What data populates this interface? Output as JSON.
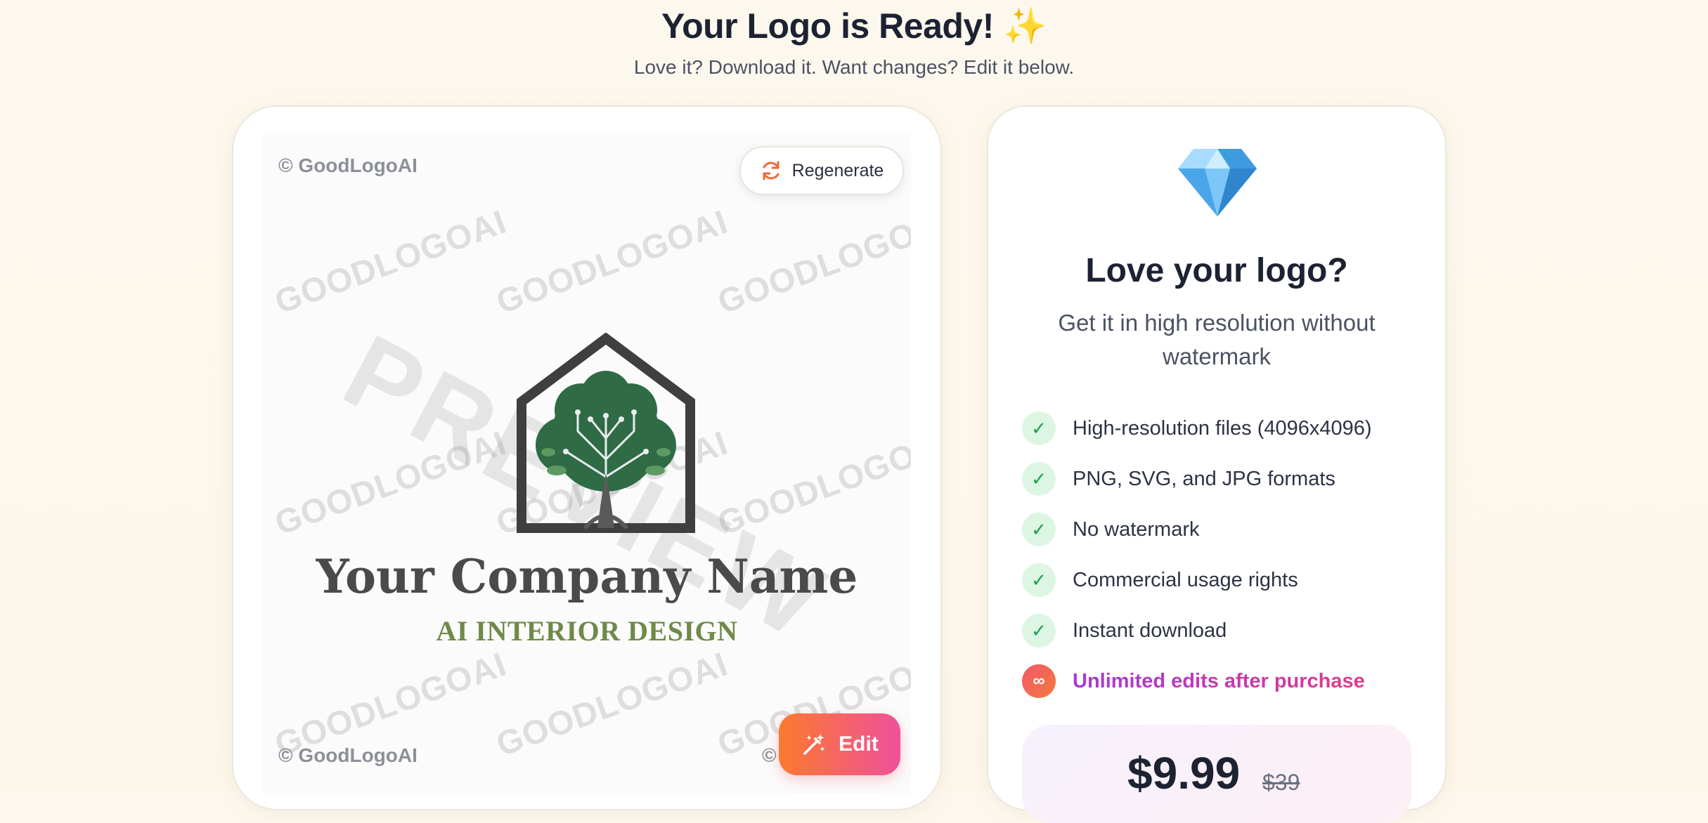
{
  "header": {
    "title": "Your Logo is Ready!",
    "sparkle": "✨",
    "subtitle": "Love it? Download it. Want changes? Edit it below."
  },
  "preview": {
    "copyright": "© GoodLogoAI",
    "copyright_partial": "© G",
    "watermark": "GOODLOGOAI",
    "preview_watermark": "PREVIEW",
    "company_name": "Your Company Name",
    "tagline": "AI INTERIOR DESIGN",
    "regenerate_label": "Regenerate",
    "edit_label": "Edit"
  },
  "offer": {
    "title": "Love your logo?",
    "subtitle": "Get it in high resolution without watermark",
    "features": [
      {
        "label": "High-resolution files (4096x4096)",
        "icon": "check-icon"
      },
      {
        "label": "PNG, SVG, and JPG formats",
        "icon": "check-icon"
      },
      {
        "label": "No watermark",
        "icon": "check-icon"
      },
      {
        "label": "Commercial usage rights",
        "icon": "check-icon"
      },
      {
        "label": "Instant download",
        "icon": "check-icon"
      },
      {
        "label": "Unlimited edits after purchase",
        "icon": "infinity-icon"
      }
    ],
    "price": "$9.99",
    "old_price": "$39"
  },
  "colors": {
    "accent_orange": "#fb7a2e",
    "accent_pink": "#f0509a",
    "check_green": "#1f9d4f",
    "logo_green": "#2f6b45",
    "tagline_green": "#6e8a48"
  }
}
